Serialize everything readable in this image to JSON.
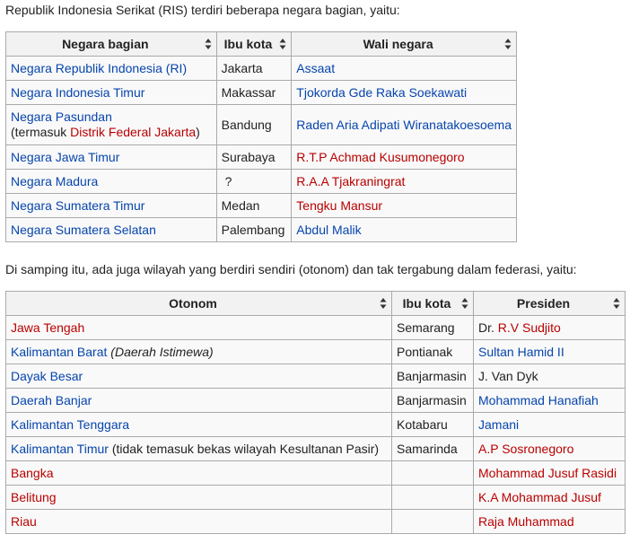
{
  "intro1": "Republik Indonesia Serikat (RIS) terdiri beberapa negara bagian, yaitu:",
  "table1": {
    "headers": [
      "Negara bagian",
      "Ibu kota",
      "Wali negara"
    ],
    "rows": [
      {
        "negara": "Negara Republik Indonesia (RI)",
        "ibu": "Jakarta",
        "wali": "Assaat"
      },
      {
        "negara": "Negara Indonesia Timur",
        "ibu": "Makassar",
        "wali": "Tjokorda Gde Raka Soekawati"
      },
      {
        "negara": "Negara Pasundan",
        "negara_note_pre": "(termasuk ",
        "negara_note_link": "Distrik Federal Jakarta",
        "negara_note_post": ")",
        "ibu": "Bandung",
        "wali": "Raden Aria Adipati Wiranatakoesoema"
      },
      {
        "negara": "Negara Jawa Timur",
        "ibu": "Surabaya",
        "wali": "R.T.P Achmad Kusumonegoro"
      },
      {
        "negara": "Negara Madura",
        "ibu": "?",
        "wali": "R.A.A Tjakraningrat"
      },
      {
        "negara": "Negara Sumatera Timur",
        "ibu": "Medan",
        "wali": "Tengku Mansur"
      },
      {
        "negara": "Negara Sumatera Selatan",
        "ibu": "Palembang",
        "wali": "Abdul Malik"
      }
    ]
  },
  "intro2": "Di samping itu, ada juga wilayah yang berdiri sendiri (otonom) dan tak tergabung dalam federasi, yaitu:",
  "table2": {
    "headers": [
      "Otonom",
      "Ibu kota",
      "Presiden"
    ],
    "rows": [
      {
        "otonom": "Jawa Tengah",
        "ibu": "Semarang",
        "pres_pre": "Dr. ",
        "pres": "R.V Sudjito"
      },
      {
        "otonom": "Kalimantan Barat",
        "otonom_note": "(Daerah Istimewa)",
        "ibu": "Pontianak",
        "pres": "Sultan Hamid II"
      },
      {
        "otonom": "Dayak Besar",
        "ibu": "Banjarmasin",
        "pres": "J. Van Dyk"
      },
      {
        "otonom": "Daerah Banjar",
        "ibu": "Banjarmasin",
        "pres": "Mohammad Hanafiah"
      },
      {
        "otonom": "Kalimantan Tenggara",
        "ibu": "Kotabaru",
        "pres": "Jamani"
      },
      {
        "otonom": "Kalimantan Timur",
        "otonom_note": "(tidak temasuk bekas wilayah Kesultanan Pasir)",
        "ibu": "Samarinda",
        "pres": "A.P Sosronegoro"
      },
      {
        "otonom": "Bangka",
        "ibu": "",
        "pres": "Mohammad Jusuf Rasidi"
      },
      {
        "otonom": "Belitung",
        "ibu": "",
        "pres": "K.A Mohammad Jusuf"
      },
      {
        "otonom": "Riau",
        "ibu": "",
        "pres": "Raja Muhammad"
      }
    ]
  },
  "colors": {
    "link_blue": "#0645ad",
    "link_red": "#ba0000",
    "border": "#aaaaaa",
    "header_bg": "#f2f2f2",
    "table_bg": "#f9f9f9"
  },
  "icons": {
    "sort": "sort-arrows-icon"
  }
}
